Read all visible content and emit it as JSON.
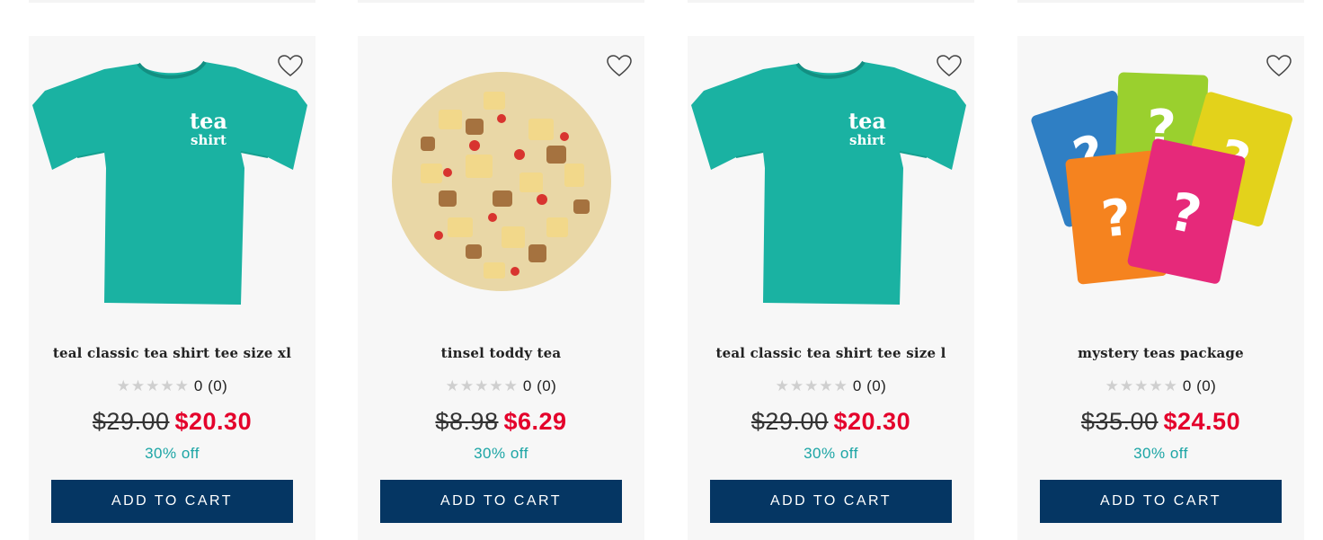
{
  "products": [
    {
      "name": "teal classic tea shirt tee size xl",
      "image_icon": "teal-tshirt-image",
      "rating_count": "0 (0)",
      "old_price": "$29.00",
      "new_price": "$20.30",
      "discount": "30% off",
      "button_label": "ADD TO CART",
      "shirt_text_line1": "tea",
      "shirt_text_line2": "shirt"
    },
    {
      "name": "tinsel toddy tea",
      "image_icon": "loose-leaf-tea-image",
      "rating_count": "0 (0)",
      "old_price": "$8.98",
      "new_price": "$6.29",
      "discount": "30% off",
      "button_label": "ADD TO CART"
    },
    {
      "name": "teal classic tea shirt tee size l",
      "image_icon": "teal-tshirt-image",
      "rating_count": "0 (0)",
      "old_price": "$29.00",
      "new_price": "$20.30",
      "discount": "30% off",
      "button_label": "ADD TO CART",
      "shirt_text_line1": "tea",
      "shirt_text_line2": "shirt"
    },
    {
      "name": "mystery teas package",
      "image_icon": "mystery-pouches-image",
      "rating_count": "0 (0)",
      "old_price": "$35.00",
      "new_price": "$24.50",
      "discount": "30% off",
      "button_label": "ADD TO CART",
      "pouch_symbol": "?"
    }
  ],
  "colors": {
    "button": "#053663",
    "sale_price": "#e4002b",
    "discount": "#1ca5a5",
    "shirt": "#1ab2a2",
    "star_empty": "#cfcfcf"
  }
}
